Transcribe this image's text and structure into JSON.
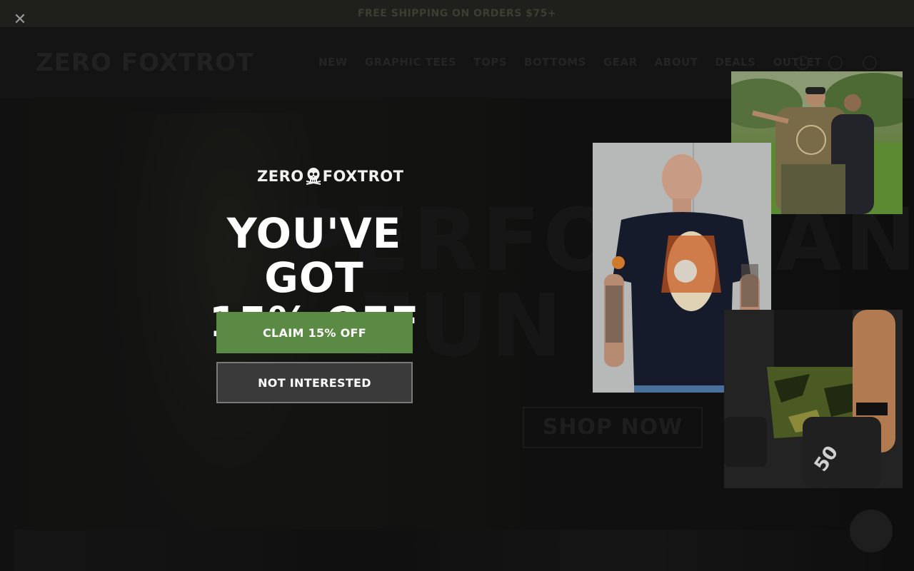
{
  "announcement": "FREE SHIPPING ON ORDERS $75+",
  "site": {
    "logo": "ZERO FOXTROT",
    "nav": [
      "NEW",
      "GRAPHIC TEES",
      "TOPS",
      "BOTTOMS",
      "GEAR",
      "ABOUT",
      "DEALS",
      "OUTLET"
    ],
    "hero_headline": "PERFORMANCE",
    "hero_subline": "FUN",
    "hero_cta": "SHOP NOW"
  },
  "popup": {
    "close_icon": "close-icon",
    "logo_left": "ZERO",
    "logo_right": "FOXTROT",
    "headline_line1": "YOU'VE GOT",
    "headline_line2": "15% OFF",
    "claim_label": "CLAIM 15% OFF",
    "decline_label": "NOT INTERESTED"
  },
  "colors": {
    "accent_green": "#5a8a44",
    "decline_bg": "#3a3a3a",
    "text": "#ffffff"
  }
}
